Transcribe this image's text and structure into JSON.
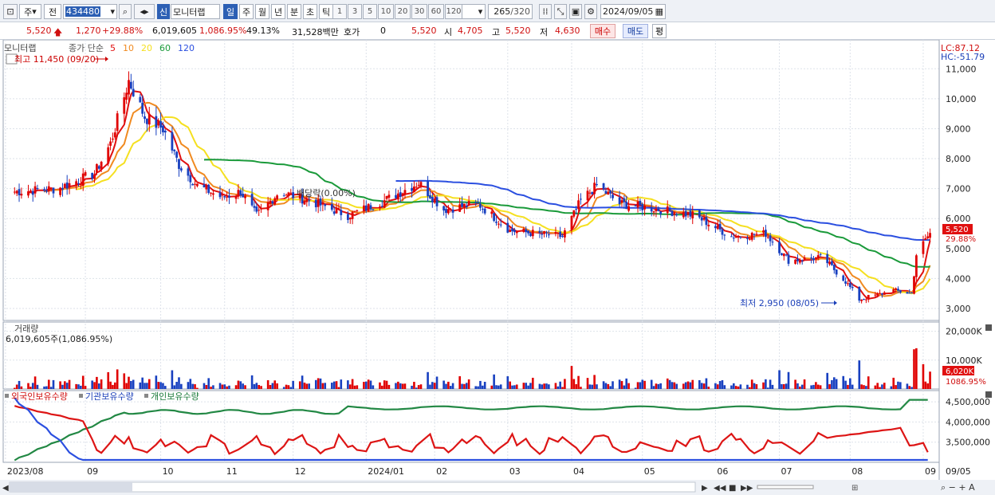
{
  "toolbar": {
    "market_label": "주",
    "type_label": "전",
    "code_value": "434480",
    "stock_badge": "신",
    "stock_name": "모니터랩",
    "period_tabs": [
      "일",
      "주",
      "월",
      "년",
      "분",
      "초",
      "틱"
    ],
    "interval_tabs": [
      "1",
      "3",
      "5",
      "10",
      "20",
      "30",
      "60",
      "120"
    ],
    "count_display": "265",
    "count_total": "/320",
    "date_value": "2024/09/05"
  },
  "quote": {
    "price": "5,520",
    "change": "1,270",
    "change_pct": "+29.88%",
    "volume": "6,019,605",
    "volume_pct": "1,086.95%",
    "turnover": "49.13%",
    "amount": "31,528백만",
    "hoga_label": "호가",
    "hoga_value": "0",
    "cur_value": "5,520",
    "open_label": "시",
    "open_value": "4,705",
    "high_label": "고",
    "high_value": "5,520",
    "low_label": "저",
    "low_value": "4,630",
    "buy_button": "매수",
    "sell_button": "매도",
    "eval_button": "평"
  },
  "colors": {
    "up": "#e00000",
    "down": "#1840c0",
    "ma5": "#e01010",
    "ma10": "#f08a20",
    "ma20": "#f5e020",
    "ma60": "#1a9a3a",
    "ma120": "#2b4fe0"
  },
  "chart_data": {
    "type": "candlestick",
    "price_panel": {
      "legend_stock": "모니터랩",
      "legend_prefix": "종가 단순",
      "legend_ma": [
        "5",
        "10",
        "20",
        "60",
        "120"
      ],
      "lc_label": "LC:87.12",
      "hc_label": "HC:-51.79",
      "y_ticks": [
        "11,000",
        "10,000",
        "9,000",
        "8,000",
        "7,000",
        "6,000",
        "5,000",
        "4,000",
        "3,000"
      ],
      "ylim": [
        2600,
        11700
      ],
      "high_annotation": "최고 11,450 (09/20)",
      "low_annotation": "최저 2,950 (08/05)",
      "dividend_annotation": "배당락(0.00%)",
      "last_price_tag": "5,520",
      "last_pct_tag": "29.88%"
    },
    "volume_panel": {
      "title": "거래량",
      "info": "6,019,605주(1,086.95%)",
      "y_ticks": [
        "20,000K",
        "10,000K"
      ],
      "last_tag": "6,020K",
      "last_pct_tag": "1086.95%"
    },
    "holding_panel": {
      "legend": [
        "외국인보유수량",
        "기관보유수량",
        "개인보유수량"
      ],
      "y_ticks": [
        "4,500,000",
        "4,000,000",
        "3,500,000"
      ]
    },
    "x_ticks": [
      "2023/08",
      "09",
      "10",
      "11",
      "12",
      "2024/01",
      "02",
      "03",
      "04",
      "05",
      "06",
      "07",
      "08",
      "09",
      "09/05"
    ],
    "close_anchors": [
      {
        "date": "2023-08-01",
        "close": 6900
      },
      {
        "date": "2023-08-20",
        "close": 7000
      },
      {
        "date": "2023-09-05",
        "close": 7500
      },
      {
        "date": "2023-09-12",
        "close": 8500
      },
      {
        "date": "2023-09-20",
        "close": 10600
      },
      {
        "date": "2023-09-27",
        "close": 9400
      },
      {
        "date": "2023-10-05",
        "close": 9000
      },
      {
        "date": "2023-10-12",
        "close": 7800
      },
      {
        "date": "2023-10-20",
        "close": 7100
      },
      {
        "date": "2023-10-31",
        "close": 6700
      },
      {
        "date": "2023-11-08",
        "close": 6900
      },
      {
        "date": "2023-11-15",
        "close": 6100
      },
      {
        "date": "2023-11-25",
        "close": 6900
      },
      {
        "date": "2023-12-08",
        "close": 6600
      },
      {
        "date": "2023-12-25",
        "close": 6100
      },
      {
        "date": "2024-01-10",
        "close": 6600
      },
      {
        "date": "2024-01-25",
        "close": 7200
      },
      {
        "date": "2024-02-05",
        "close": 6300
      },
      {
        "date": "2024-02-20",
        "close": 6500
      },
      {
        "date": "2024-03-05",
        "close": 5600
      },
      {
        "date": "2024-03-28",
        "close": 5400
      },
      {
        "date": "2024-04-05",
        "close": 6600
      },
      {
        "date": "2024-04-12",
        "close": 7100
      },
      {
        "date": "2024-04-22",
        "close": 6500
      },
      {
        "date": "2024-05-10",
        "close": 6300
      },
      {
        "date": "2024-05-25",
        "close": 6100
      },
      {
        "date": "2024-06-10",
        "close": 5400
      },
      {
        "date": "2024-06-25",
        "close": 5500
      },
      {
        "date": "2024-07-05",
        "close": 4600
      },
      {
        "date": "2024-07-20",
        "close": 4700
      },
      {
        "date": "2024-07-30",
        "close": 3900
      },
      {
        "date": "2024-08-05",
        "close": 3300
      },
      {
        "date": "2024-08-20",
        "close": 3600
      },
      {
        "date": "2024-08-28",
        "close": 3500
      },
      {
        "date": "2024-08-30",
        "close": 4800
      },
      {
        "date": "2024-09-05",
        "close": 5520
      }
    ]
  }
}
